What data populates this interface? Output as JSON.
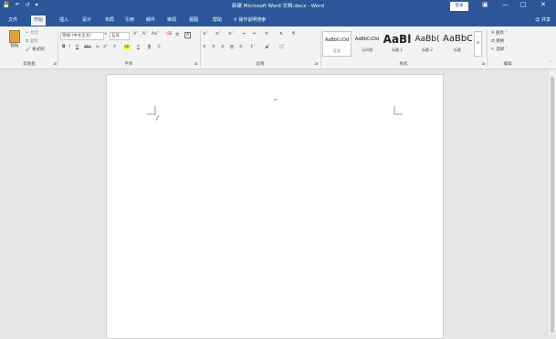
{
  "titlebar": {
    "title": "新建 Microsoft Word 文档.docx  -  Word",
    "login": "登录",
    "qa_icons": [
      "save-icon",
      "undo-icon",
      "redo-icon",
      "customize-icon"
    ]
  },
  "tabs": [
    "文件",
    "开始",
    "插入",
    "设计",
    "布局",
    "引用",
    "邮件",
    "审阅",
    "视图",
    "帮助"
  ],
  "active_tab": "开始",
  "tell_me": "操作说明搜索",
  "share": "共享",
  "clipboard": {
    "paste": "粘贴",
    "cut": "剪切",
    "copy": "复制",
    "format_painter": "格式刷",
    "label": "剪贴板"
  },
  "font": {
    "font_name": "等线 (中文正文)",
    "font_size": "五号",
    "label": "字体"
  },
  "paragraph": {
    "label": "段落"
  },
  "styles": {
    "items": [
      {
        "sample": "AaBbCcDd",
        "name": "正文"
      },
      {
        "sample": "AaBbCcDd",
        "name": "无间隔"
      },
      {
        "sample": "AaBl",
        "name": "标题 1"
      },
      {
        "sample": "AaBb(",
        "name": "标题 2"
      },
      {
        "sample": "AaBbC",
        "name": "标题"
      }
    ],
    "label": "样式"
  },
  "editing": {
    "find": "查找",
    "replace": "替换",
    "select": "选择",
    "label": "编辑"
  }
}
